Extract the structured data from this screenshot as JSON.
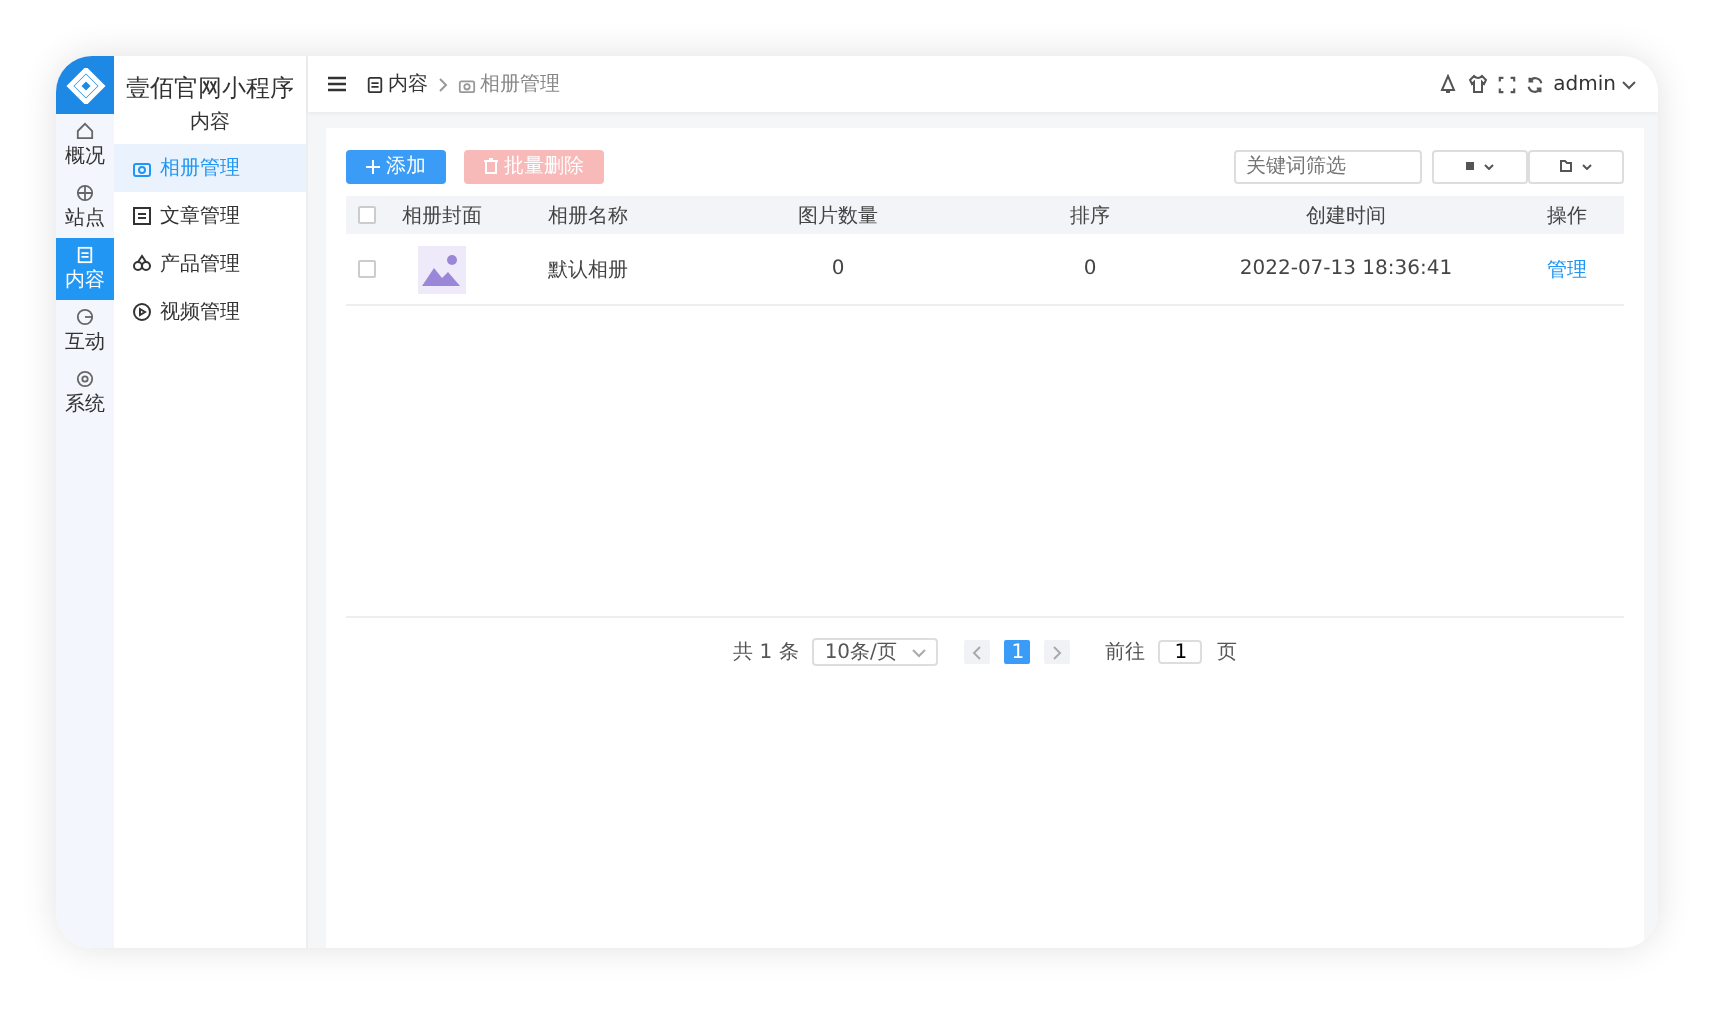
{
  "app": {
    "title": "壹佰官网小程序",
    "section": "内容"
  },
  "rail": [
    {
      "label": "概况",
      "selected": false
    },
    {
      "label": "站点",
      "selected": false
    },
    {
      "label": "内容",
      "selected": true
    },
    {
      "label": "互动",
      "selected": false
    },
    {
      "label": "系统",
      "selected": false
    }
  ],
  "menu": [
    {
      "label": "相册管理",
      "selected": true
    },
    {
      "label": "文章管理",
      "selected": false
    },
    {
      "label": "产品管理",
      "selected": false
    },
    {
      "label": "视频管理",
      "selected": false
    }
  ],
  "breadcrumb": [
    "内容",
    "相册管理"
  ],
  "header": {
    "user": "admin"
  },
  "toolbar": {
    "add": "添加",
    "batch_delete": "批量删除",
    "batch_delete_disabled": true,
    "search_placeholder": "关键词筛选"
  },
  "table": {
    "all_checked": false,
    "columns": [
      "相册封面",
      "相册名称",
      "图片数量",
      "排序",
      "创建时间",
      "操作"
    ],
    "rows": [
      {
        "checked": false,
        "name": "默认相册",
        "count": "0",
        "order": "0",
        "created": "2022-07-13 18:36:41",
        "action": "管理"
      }
    ]
  },
  "pagination": {
    "total": "共 1 条",
    "page_size": "10条/页",
    "pages": [
      {
        "label": "1",
        "selected": true
      }
    ],
    "goto_label": "前往",
    "goto_value": "1",
    "goto_suffix": "页"
  }
}
